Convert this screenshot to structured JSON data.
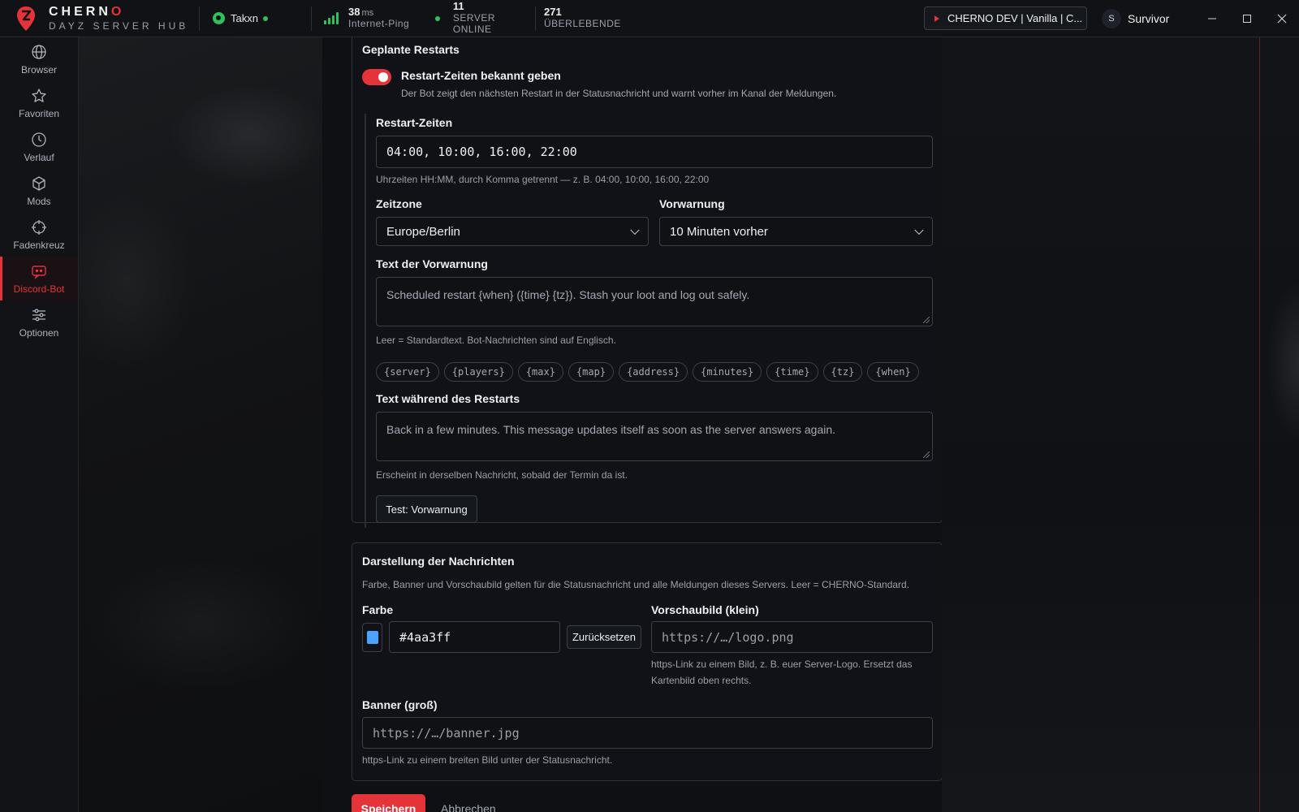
{
  "app": {
    "logo_name_main": "CHERN",
    "logo_name_accent": "O",
    "logo_sub": "DAYZ SERVER HUB",
    "brand_color": "#e5333a"
  },
  "topbar": {
    "user": "Takxn",
    "ping_value": "38",
    "ping_unit": "ms",
    "ping_label": "Internet-Ping",
    "online_value": "11",
    "online_label": "SERVER ONLINE",
    "players_value": "271",
    "players_label": "ÜBERLEBENDE",
    "server_name": "CHERNO DEV | Vanilla | C...",
    "profile_initial": "S",
    "profile_name": "Survivor"
  },
  "sidebar": {
    "items": [
      {
        "label": "Browser",
        "icon": "globe-icon"
      },
      {
        "label": "Favoriten",
        "icon": "star-icon"
      },
      {
        "label": "Verlauf",
        "icon": "clock-icon"
      },
      {
        "label": "Mods",
        "icon": "cube-icon"
      },
      {
        "label": "Fadenkreuz",
        "icon": "crosshair-icon"
      },
      {
        "label": "Discord-Bot",
        "icon": "bot-icon",
        "active": true
      },
      {
        "label": "Optionen",
        "icon": "sliders-icon"
      }
    ]
  },
  "restarts": {
    "section_title": "Geplante Restarts",
    "toggle_label": "Restart-Zeiten bekannt geben",
    "toggle_on": true,
    "toggle_desc": "Der Bot zeigt den nächsten Restart in der Statusnachricht und warnt vorher im Kanal der Meldungen.",
    "times_label": "Restart-Zeiten",
    "times_value": "04:00, 10:00, 16:00, 22:00",
    "times_hint": "Uhrzeiten HH:MM, durch Komma getrennt — z. B. 04:00, 10:00, 16:00, 22:00",
    "timezone_label": "Zeitzone",
    "timezone_value": "Europe/Berlin",
    "warning_label": "Vorwarnung",
    "warning_value": "10 Minuten vorher",
    "warning_text_label": "Text der Vorwarnung",
    "warning_text_placeholder": "Scheduled restart {when} ({time} {tz}). Stash your loot and log out safely.",
    "warning_text_hint": "Leer = Standardtext. Bot-Nachrichten sind auf Englisch.",
    "placeholders": [
      "{server}",
      "{players}",
      "{max}",
      "{map}",
      "{address}",
      "{minutes}",
      "{time}",
      "{tz}",
      "{when}"
    ],
    "during_label": "Text während des Restarts",
    "during_placeholder": "Back in a few minutes. This message updates itself as soon as the server answers again.",
    "during_hint": "Erscheint in derselben Nachricht, sobald der Termin da ist.",
    "test_button": "Test: Vorwarnung"
  },
  "appearance": {
    "section_title": "Darstellung der Nachrichten",
    "desc": "Farbe, Banner und Vorschaubild gelten für die Statusnachricht und alle Meldungen dieses Servers. Leer = CHERNO-Standard.",
    "color_label": "Farbe",
    "color_value": "#4aa3ff",
    "reset_button": "Zurücksetzen",
    "thumb_label": "Vorschaubild (klein)",
    "thumb_placeholder": "https://…/logo.png",
    "thumb_hint": "https-Link zu einem Bild, z. B. euer Server-Logo. Ersetzt das Kartenbild oben rechts.",
    "banner_label": "Banner (groß)",
    "banner_placeholder": "https://…/banner.jpg",
    "banner_hint": "https-Link zu einem breiten Bild unter der Statusnachricht."
  },
  "actions": {
    "save": "Speichern",
    "cancel": "Abbrechen"
  }
}
